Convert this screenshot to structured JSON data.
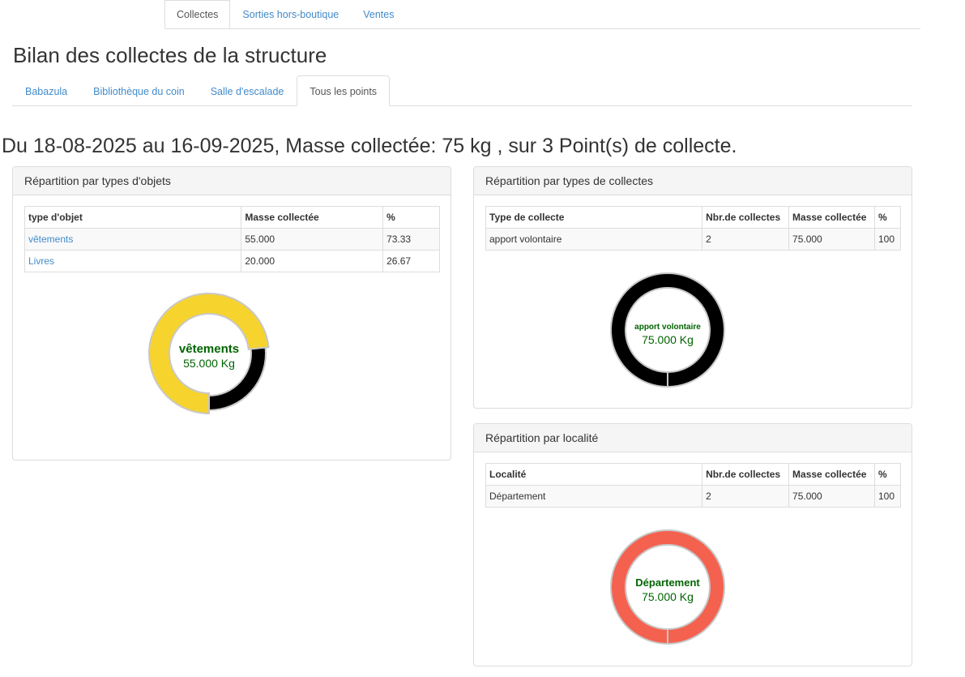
{
  "top_tabs": [
    {
      "label": "Collectes",
      "active": true
    },
    {
      "label": "Sorties hors-boutique",
      "active": false
    },
    {
      "label": "Ventes",
      "active": false
    }
  ],
  "page_title": "Bilan des collectes de la structure",
  "sub_tabs": [
    {
      "label": "Babazula",
      "active": false
    },
    {
      "label": "Bibliothèque du coin",
      "active": false
    },
    {
      "label": "Salle d'escalade",
      "active": false
    },
    {
      "label": "Tous les points",
      "active": true
    }
  ],
  "summary": "Du 18-08-2025 au 16-09-2025, Masse collectée: 75 kg , sur 3 Point(s) de collecte.",
  "panels": {
    "objets": {
      "title": "Répartition par types d'objets",
      "headers": [
        "type d'objet",
        "Masse collectée",
        "%"
      ],
      "rows": [
        {
          "type": "vêtements",
          "masse": "55.000",
          "pct": "73.33"
        },
        {
          "type": "Livres",
          "masse": "20.000",
          "pct": "26.67"
        }
      ]
    },
    "types": {
      "title": "Répartition par types de collectes",
      "headers": [
        "Type de collecte",
        "Nbr.de collectes",
        "Masse collectée",
        "%"
      ],
      "rows": [
        {
          "type": "apport volontaire",
          "nbr": "2",
          "masse": "75.000",
          "pct": "100"
        }
      ]
    },
    "localite": {
      "title": "Répartition par localité",
      "headers": [
        "Localité",
        "Nbr.de collectes",
        "Masse collectée",
        "%"
      ],
      "rows": [
        {
          "type": "Département",
          "nbr": "2",
          "masse": "75.000",
          "pct": "100"
        }
      ]
    }
  },
  "chart_data": [
    {
      "type": "pie",
      "categories": [
        "vêtements",
        "Livres"
      ],
      "values": [
        55.0,
        20.0
      ],
      "colors": [
        "#f6d32d",
        "#000000"
      ],
      "highlight": "vêtements",
      "center_label": "vêtements",
      "center_value": "55.000 Kg"
    },
    {
      "type": "pie",
      "categories": [
        "apport volontaire"
      ],
      "values": [
        75.0
      ],
      "colors": [
        "#000000"
      ],
      "center_label": "apport volontaire",
      "center_value": "75.000 Kg"
    },
    {
      "type": "pie",
      "categories": [
        "Département"
      ],
      "values": [
        75.0
      ],
      "colors": [
        "#f5614f"
      ],
      "center_label": "Département",
      "center_value": "75.000 Kg"
    }
  ]
}
